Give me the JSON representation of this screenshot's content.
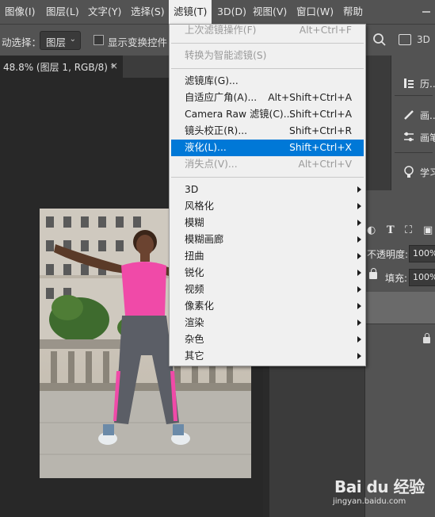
{
  "menubar": {
    "items": [
      {
        "label": "图像(I)"
      },
      {
        "label": "图层(L)"
      },
      {
        "label": "文字(Y)"
      },
      {
        "label": "选择(S)"
      },
      {
        "label": "滤镜(T)"
      },
      {
        "label": "3D(D)"
      },
      {
        "label": "视图(V)"
      },
      {
        "label": "窗口(W)"
      },
      {
        "label": "帮助"
      }
    ]
  },
  "options": {
    "select_label": "动选择：",
    "select_value": "图层",
    "checkbox_label": "显示变换控件",
    "mode_label": "3D"
  },
  "document": {
    "tab_title": "48.8% (图层 1, RGB/8) *",
    "close_glyph": "×"
  },
  "filter_menu": {
    "items": [
      {
        "label": "上次滤镜操作(F)",
        "shortcut": "Alt+Ctrl+F"
      },
      {
        "label": "转换为智能滤镜(S)",
        "shortcut": ""
      },
      {
        "label": "滤镜库(G)...",
        "shortcut": ""
      },
      {
        "label": "自适应广角(A)...",
        "shortcut": "Alt+Shift+Ctrl+A"
      },
      {
        "label": "Camera Raw 滤镜(C)...",
        "shortcut": "Shift+Ctrl+A"
      },
      {
        "label": "镜头校正(R)...",
        "shortcut": "Shift+Ctrl+R"
      },
      {
        "label": "液化(L)...",
        "shortcut": "Shift+Ctrl+X"
      },
      {
        "label": "消失点(V)...",
        "shortcut": "Alt+Ctrl+V"
      },
      {
        "label": "3D"
      },
      {
        "label": "风格化"
      },
      {
        "label": "模糊"
      },
      {
        "label": "模糊画廊"
      },
      {
        "label": "扭曲"
      },
      {
        "label": "锐化"
      },
      {
        "label": "视频"
      },
      {
        "label": "像素化"
      },
      {
        "label": "渲染"
      },
      {
        "label": "杂色"
      },
      {
        "label": "其它"
      }
    ]
  },
  "panels": {
    "items": [
      {
        "label": "历..."
      },
      {
        "label": "画..."
      },
      {
        "label": "画笔"
      },
      {
        "label": "学习"
      }
    ]
  },
  "layers": {
    "opacity_label": "不透明度:",
    "opacity_value": "100%",
    "fill_label": "填充:",
    "fill_value": "100%"
  },
  "watermark": {
    "brand": "Bai du 经验",
    "url": "jingyan.baidu.com"
  },
  "colors": {
    "menu_highlight": "#0078d7",
    "menubar_bg": "#535353",
    "canvas_bg": "#282828"
  }
}
